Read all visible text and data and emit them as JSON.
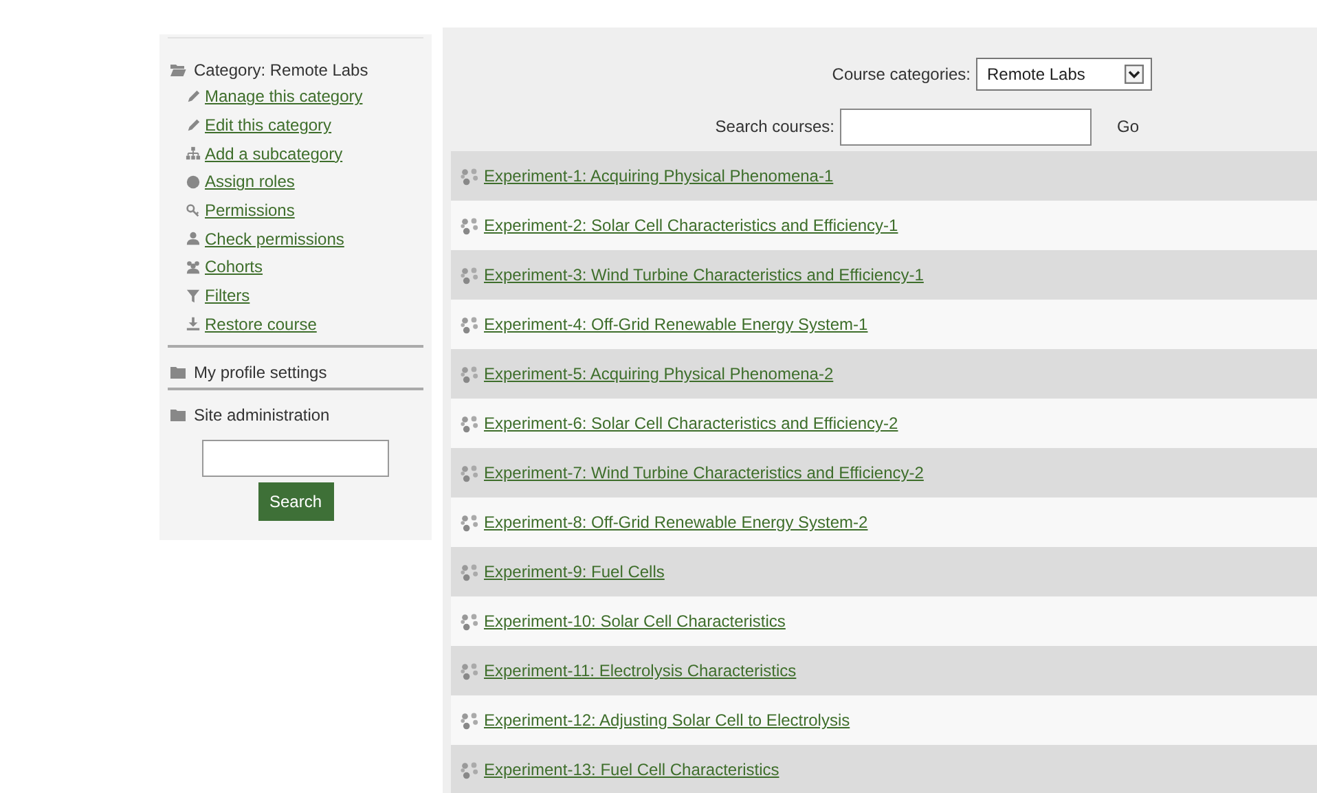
{
  "sidebar": {
    "category": "Category: Remote Labs",
    "links": [
      {
        "label": "Manage this category",
        "kind": "pencil"
      },
      {
        "label": "Edit this category",
        "kind": "pencil"
      },
      {
        "label": "Add a subcategory",
        "kind": "tree"
      },
      {
        "label": "Assign roles",
        "kind": "dot"
      },
      {
        "label": "Permissions",
        "kind": "key"
      },
      {
        "label": "Check permissions",
        "kind": "user"
      },
      {
        "label": "Cohorts",
        "kind": "users"
      },
      {
        "label": "Filters",
        "kind": "filter"
      },
      {
        "label": "Restore course",
        "kind": "download"
      }
    ],
    "sections": [
      "My profile settings",
      "Site administration"
    ],
    "search_button": "Search"
  },
  "main": {
    "category_label": "Course categories:",
    "category_value": "Remote Labs",
    "search_label": "Search courses:",
    "go": "Go",
    "courses": [
      "Experiment-1: Acquiring Physical Phenomena-1",
      "Experiment-2: Solar Cell Characteristics and Efficiency-1",
      "Experiment-3: Wind Turbine Characteristics and Efficiency-1",
      "Experiment-4: Off-Grid Renewable Energy System-1",
      "Experiment-5: Acquiring Physical Phenomena-2",
      "Experiment-6: Solar Cell Characteristics and Efficiency-2",
      "Experiment-7: Wind Turbine Characteristics and Efficiency-2",
      "Experiment-8: Off-Grid Renewable Energy System-2",
      "Experiment-9: Fuel Cells",
      "Experiment-10: Solar Cell Characteristics",
      "Experiment-11: Electrolysis Characteristics",
      "Experiment-12: Adjusting Solar Cell to Electrolysis",
      "Experiment-13: Fuel Cell Characteristics"
    ]
  }
}
